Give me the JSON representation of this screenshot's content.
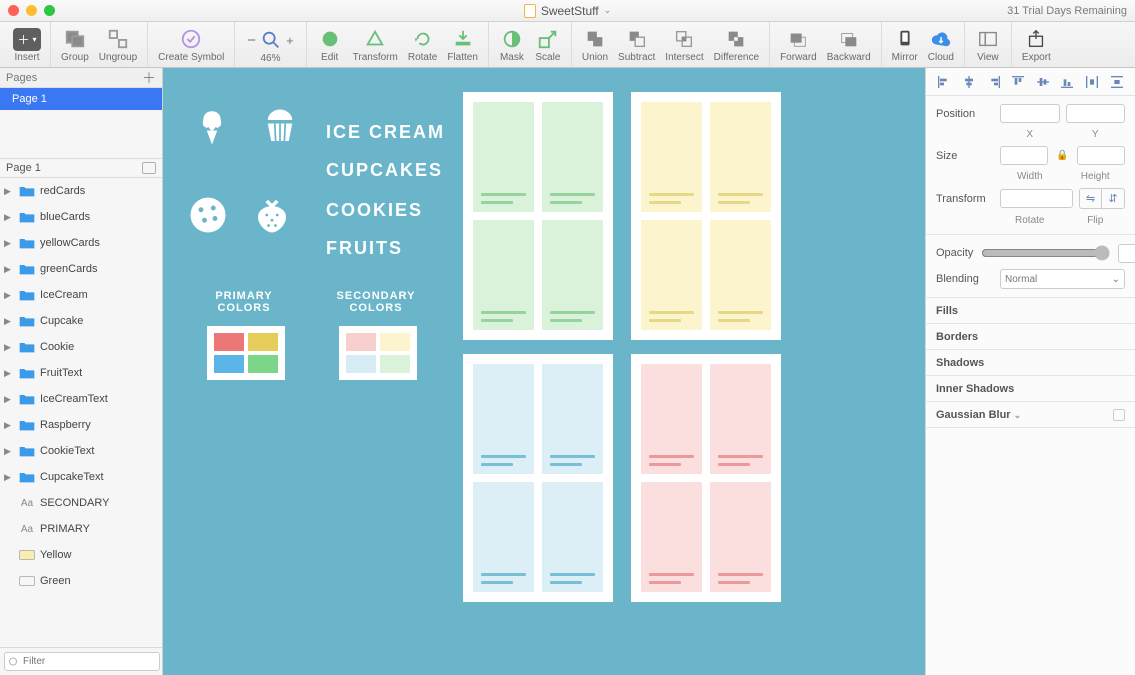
{
  "titlebar": {
    "doc_name": "SweetStuff",
    "trial_text": "31 Trial Days Remaining"
  },
  "toolbar": {
    "insert": "Insert",
    "group": "Group",
    "ungroup": "Ungroup",
    "create_symbol": "Create Symbol",
    "zoom": "46%",
    "edit": "Edit",
    "transform": "Transform",
    "rotate": "Rotate",
    "flatten": "Flatten",
    "mask": "Mask",
    "scale": "Scale",
    "union": "Union",
    "subtract": "Subtract",
    "intersect": "Intersect",
    "difference": "Difference",
    "forward": "Forward",
    "backward": "Backward",
    "mirror": "Mirror",
    "cloud": "Cloud",
    "view": "View",
    "export": "Export"
  },
  "sidebar": {
    "pages_header": "Pages",
    "current_page": "Page 1",
    "artboard_header": "Page 1",
    "layers": [
      {
        "type": "folder",
        "color": "#3c9be8",
        "name": "redCards"
      },
      {
        "type": "folder",
        "color": "#3c9be8",
        "name": "blueCards"
      },
      {
        "type": "folder",
        "color": "#3c9be8",
        "name": "yellowCards"
      },
      {
        "type": "folder",
        "color": "#3c9be8",
        "name": "greenCards"
      },
      {
        "type": "folder",
        "color": "#3c9be8",
        "name": "IceCream"
      },
      {
        "type": "folder",
        "color": "#3c9be8",
        "name": "Cupcake"
      },
      {
        "type": "folder",
        "color": "#3c9be8",
        "name": "Cookie"
      },
      {
        "type": "folder",
        "color": "#3c9be8",
        "name": "FruitText"
      },
      {
        "type": "folder",
        "color": "#3c9be8",
        "name": "IceCreamText"
      },
      {
        "type": "folder",
        "color": "#3c9be8",
        "name": "Raspberry"
      },
      {
        "type": "folder",
        "color": "#3c9be8",
        "name": "CookieText"
      },
      {
        "type": "folder",
        "color": "#3c9be8",
        "name": "CupcakeText"
      },
      {
        "type": "text",
        "name": "SECONDARY"
      },
      {
        "type": "text",
        "name": "PRIMARY"
      },
      {
        "type": "yellow",
        "name": "Yellow"
      },
      {
        "type": "empty",
        "name": "Green"
      }
    ],
    "filter_placeholder": "Filter",
    "layer_count": "12"
  },
  "canvas": {
    "categories": [
      "ICE CREAM",
      "CUPCAKES",
      "COOKIES",
      "FRUITS"
    ],
    "primary_label_l1": "PRIMARY",
    "primary_label_l2": "COLORS",
    "secondary_label_l1": "SECONDARY",
    "secondary_label_l2": "COLORS",
    "primary_swatches": [
      "#ed7777",
      "#e6cc5b",
      "#5bb5e6",
      "#7cd68a"
    ],
    "secondary_swatches": [
      "#f7cfcf",
      "#fbf4cd",
      "#d7edf6",
      "#d9f2d9"
    ]
  },
  "inspector": {
    "position": "Position",
    "x": "X",
    "y": "Y",
    "size": "Size",
    "width": "Width",
    "height": "Height",
    "transform": "Transform",
    "rotate": "Rotate",
    "flip": "Flip",
    "opacity": "Opacity",
    "blending": "Blending",
    "blending_value": "Normal",
    "fills": "Fills",
    "borders": "Borders",
    "shadows": "Shadows",
    "inner_shadows": "Inner Shadows",
    "gaussian_blur": "Gaussian Blur"
  }
}
